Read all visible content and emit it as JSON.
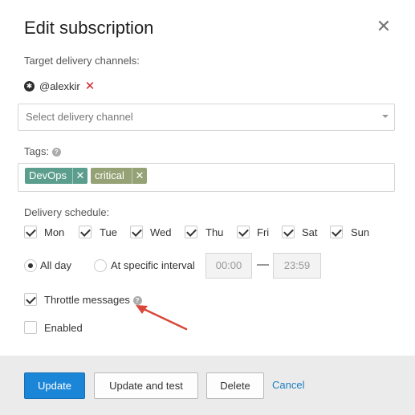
{
  "dialog": {
    "title": "Edit subscription",
    "close_symbol": "✕"
  },
  "channels": {
    "label": "Target delivery channels:",
    "items": [
      {
        "icon": "slack-icon",
        "name": "@alexkir",
        "remove_symbol": "✕"
      }
    ],
    "select_placeholder": "Select delivery channel"
  },
  "tags": {
    "label": "Tags:",
    "help_symbol": "?",
    "items": [
      {
        "label": "DevOps",
        "color": "#5b9e8d"
      },
      {
        "label": "critical",
        "color": "#94a275"
      }
    ],
    "remove_symbol": "✕"
  },
  "schedule": {
    "label": "Delivery schedule:",
    "days": [
      {
        "label": "Mon",
        "checked": true
      },
      {
        "label": "Tue",
        "checked": true
      },
      {
        "label": "Wed",
        "checked": true
      },
      {
        "label": "Thu",
        "checked": true
      },
      {
        "label": "Fri",
        "checked": true
      },
      {
        "label": "Sat",
        "checked": true
      },
      {
        "label": "Sun",
        "checked": true
      }
    ],
    "all_day_label": "All day",
    "interval_label": "At specific interval",
    "selected": "all_day",
    "time_from": "00:00",
    "time_to": "23:59",
    "separator": "—"
  },
  "options": {
    "throttle_label": "Throttle messages",
    "throttle_checked": true,
    "help_symbol": "?",
    "enabled_label": "Enabled",
    "enabled_checked": false
  },
  "footer": {
    "update_label": "Update",
    "update_test_label": "Update and test",
    "delete_label": "Delete",
    "cancel_label": "Cancel"
  },
  "colors": {
    "primary": "#1b86d7",
    "link": "#1b7ec2",
    "remove": "#d3242c",
    "annotation_arrow": "#d9473b"
  }
}
